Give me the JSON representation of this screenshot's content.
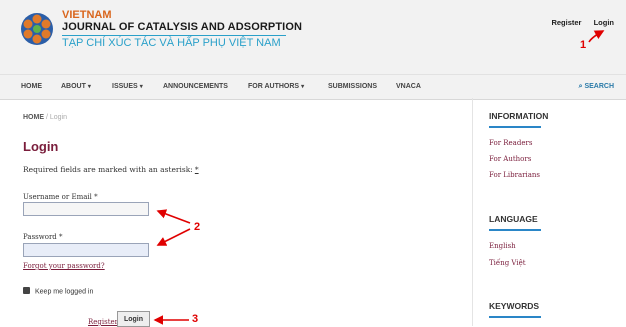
{
  "brand": {
    "name_vn": "VIETNAM",
    "name_en": "JOURNAL OF CATALYSIS AND ADSORPTION",
    "name_viet": "TẠP CHÍ XÚC TÁC VÀ HẤP PHỤ VIỆT NAM"
  },
  "user_links": {
    "register": "Register",
    "login": "Login"
  },
  "nav": {
    "items": [
      "HOME",
      "ABOUT",
      "ISSUES",
      "ANNOUNCEMENTS",
      "FOR AUTHORS",
      "SUBMISSIONS",
      "VNACA"
    ],
    "search": "SEARCH"
  },
  "breadcrumb": {
    "home": "HOME",
    "sep": "/",
    "current": "Login"
  },
  "page_title": "Login",
  "required_note": "Required fields are marked with an asterisk:",
  "required_mark": "*",
  "form": {
    "username_label": "Username or Email *",
    "username_value": "",
    "password_label": "Password *",
    "password_value": "",
    "forgot": "Forgot your password?",
    "keep_logged": "Keep me logged in",
    "keep_checked": true,
    "register": "Register",
    "login": "Login"
  },
  "sidebar": {
    "information": {
      "heading": "INFORMATION",
      "links": [
        "For Readers",
        "For Authors",
        "For Librarians"
      ]
    },
    "language": {
      "heading": "LANGUAGE",
      "links": [
        "English",
        "Tiếng Việt"
      ]
    },
    "keywords": {
      "heading": "KEYWORDS"
    }
  },
  "annotations": {
    "one": "1",
    "two": "2",
    "three": "3"
  },
  "colors": {
    "accent": "#7a1d3b",
    "brand_orange": "#d9661d",
    "brand_blue": "#2aa0c9",
    "annotation": "#e00000"
  }
}
